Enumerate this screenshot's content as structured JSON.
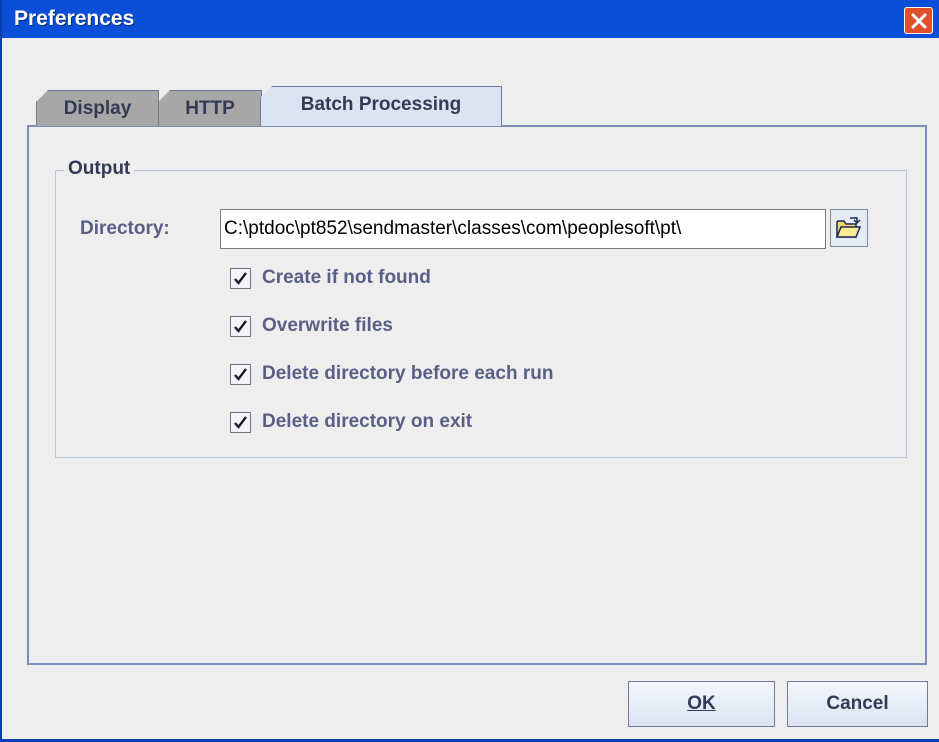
{
  "window": {
    "title": "Preferences"
  },
  "tabs": [
    {
      "label": "Display",
      "active": false
    },
    {
      "label": "HTTP",
      "active": false
    },
    {
      "label": "Batch Processing",
      "active": true
    }
  ],
  "output": {
    "legend": "Output",
    "directory_label": "Directory:",
    "directory_value": "C:\\ptdoc\\pt852\\sendmaster\\classes\\com\\peoplesoft\\pt\\",
    "options": [
      {
        "label": "Create if not found",
        "checked": true
      },
      {
        "label": "Overwrite files",
        "checked": true
      },
      {
        "label": "Delete directory before each run",
        "checked": true
      },
      {
        "label": "Delete directory on exit",
        "checked": true
      }
    ]
  },
  "buttons": {
    "ok_label": "OK",
    "cancel_label": "Cancel"
  },
  "icons": {
    "close": "close-icon",
    "browse": "open-folder-icon",
    "check": "checkmark-icon"
  },
  "colors": {
    "titlebar": "#0b4fd8",
    "close_button": "#e0502a",
    "active_tab": "#dce4f2",
    "inactive_tab": "#a7a7a7",
    "label_text": "#5a5f86"
  }
}
